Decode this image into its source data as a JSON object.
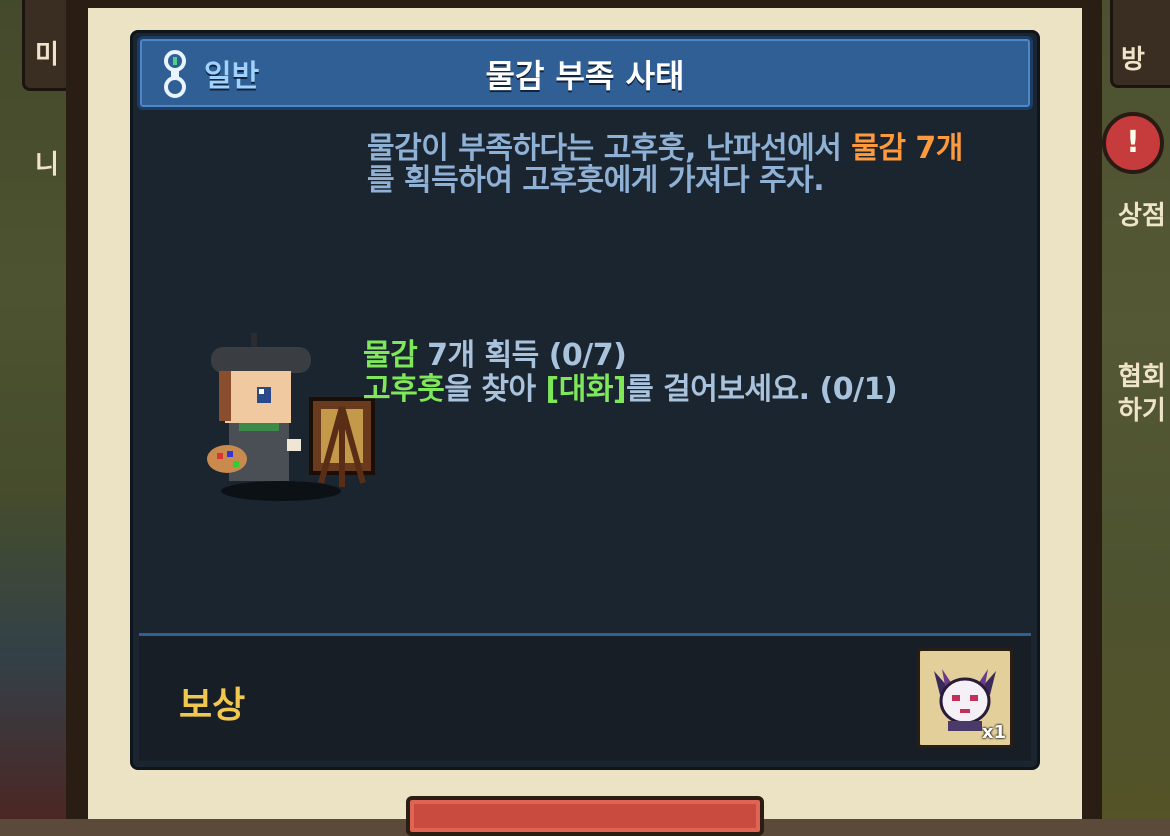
{
  "hud": {
    "mini_label": "미니",
    "bag_label": "방",
    "alert_symbol": "!",
    "shop_label": "상점",
    "association_label": "협회\n하기"
  },
  "quest": {
    "category": "일반",
    "title": "물감 부족 사태",
    "description": {
      "part1": "물감이 부족하다는 고후훗, 난파선에서 ",
      "highlight": "물감 7개",
      "part2": "를 획득하여 고후훗에게 가져다 주자."
    },
    "objectives": [
      {
        "highlight": "물감",
        "text": " 7개 획득 (0/7)"
      },
      {
        "highlight": "고후훗",
        "text_mid": "을 찾아 ",
        "highlight2": "[대화]",
        "text": "를 걸어보세요. (0/1)"
      }
    ],
    "reward": {
      "label": "보상",
      "item_icon": "cat-mask-icon",
      "count": "x1"
    }
  },
  "colors": {
    "header_blue": "#2f5f94",
    "category_blue": "#9fd2ff",
    "desc_text": "#8fb1d6",
    "highlight_orange": "#ff9a3c",
    "highlight_green": "#7ee85a",
    "reward_gold": "#f0c850",
    "button_red": "#c94b3f"
  }
}
